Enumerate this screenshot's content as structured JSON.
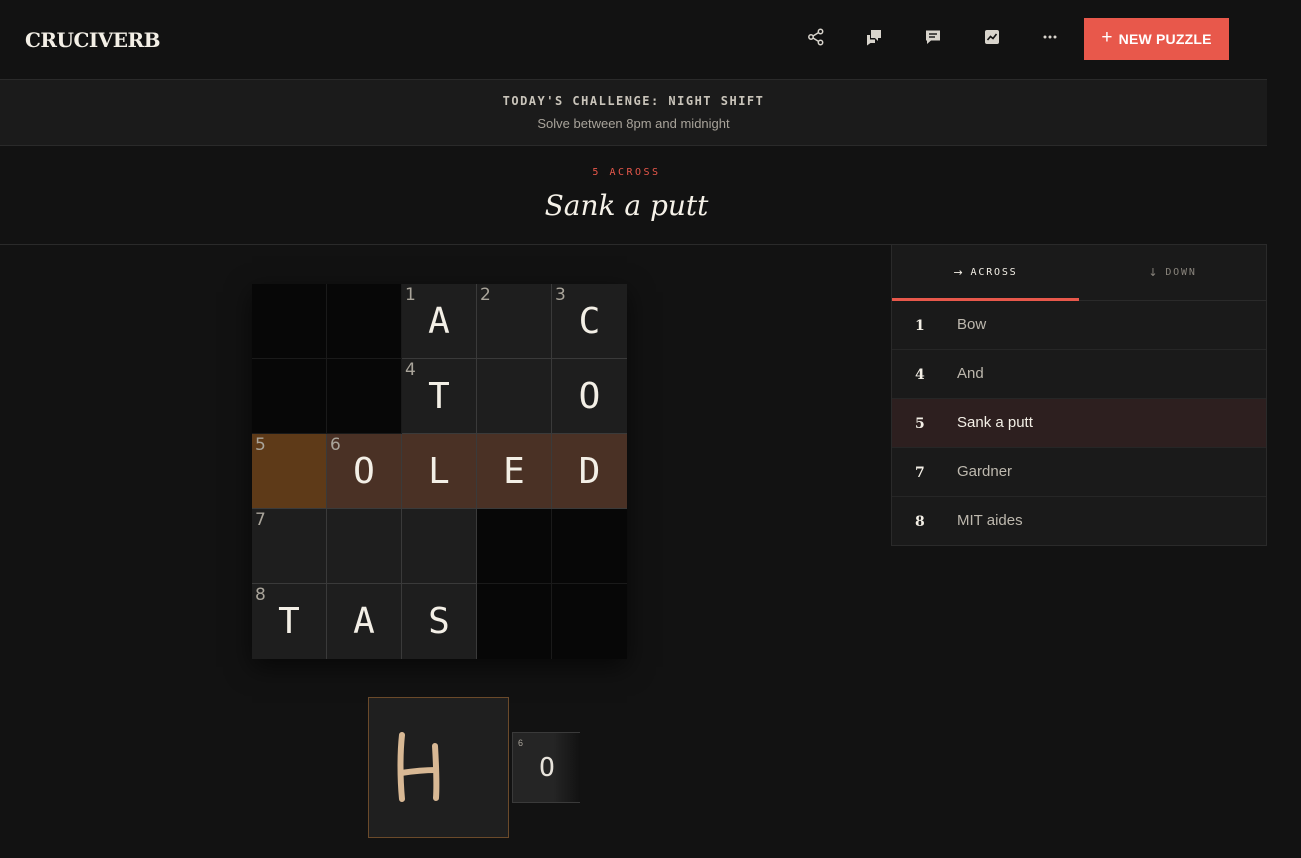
{
  "header": {
    "logo": "CRUCIVERB",
    "new_button_plus": "+",
    "new_button_label": "NEW PUZZLE",
    "tools": [
      "share-icon",
      "chat-bubbles-icon",
      "comment-icon",
      "stats-icon",
      "more-icon"
    ]
  },
  "banner": {
    "title": "TODAY'S CHALLENGE: NIGHT SHIFT",
    "subtitle": "Solve between 8pm and midnight"
  },
  "current_clue": {
    "label": "5 ACROSS",
    "text": "Sank a putt"
  },
  "grid": {
    "rows": [
      [
        {
          "black": true
        },
        {
          "black": true
        },
        {
          "num": "1",
          "letter": "A"
        },
        {
          "num": "2",
          "letter": ""
        },
        {
          "num": "3",
          "letter": "C"
        }
      ],
      [
        {
          "black": true
        },
        {
          "black": true
        },
        {
          "num": "4",
          "letter": "T"
        },
        {
          "letter": ""
        },
        {
          "letter": "O"
        }
      ],
      [
        {
          "num": "5",
          "letter": "",
          "state": "current"
        },
        {
          "num": "6",
          "letter": "O",
          "state": "highlight"
        },
        {
          "letter": "L",
          "state": "highlight"
        },
        {
          "letter": "E",
          "state": "highlight"
        },
        {
          "letter": "D",
          "state": "highlight"
        }
      ],
      [
        {
          "num": "7",
          "letter": ""
        },
        {
          "letter": ""
        },
        {
          "letter": ""
        },
        {
          "black": true
        },
        {
          "black": true
        }
      ],
      [
        {
          "num": "8",
          "letter": "T"
        },
        {
          "letter": "A"
        },
        {
          "letter": "S"
        },
        {
          "black": true
        },
        {
          "black": true
        }
      ]
    ]
  },
  "input": {
    "drawn_glyph": "H",
    "next_cell_number": "6",
    "next_cell_letter": "O",
    "stroke_color": "#d8b894"
  },
  "clues_panel": {
    "tabs": [
      {
        "icon": "→",
        "label": "ACROSS",
        "active": true
      },
      {
        "icon": "↓",
        "label": "DOWN",
        "active": false
      }
    ],
    "across": [
      {
        "num": "1",
        "text": "Bow"
      },
      {
        "num": "4",
        "text": "And"
      },
      {
        "num": "5",
        "text": "Sank a putt",
        "active": true
      },
      {
        "num": "7",
        "text": "Gardner"
      },
      {
        "num": "8",
        "text": "MIT aides"
      }
    ]
  },
  "colors": {
    "accent": "#e8584b",
    "current_cell": "#5e3a18",
    "highlight_cell": "#4a3125",
    "active_clue": "#2d1f1f"
  }
}
